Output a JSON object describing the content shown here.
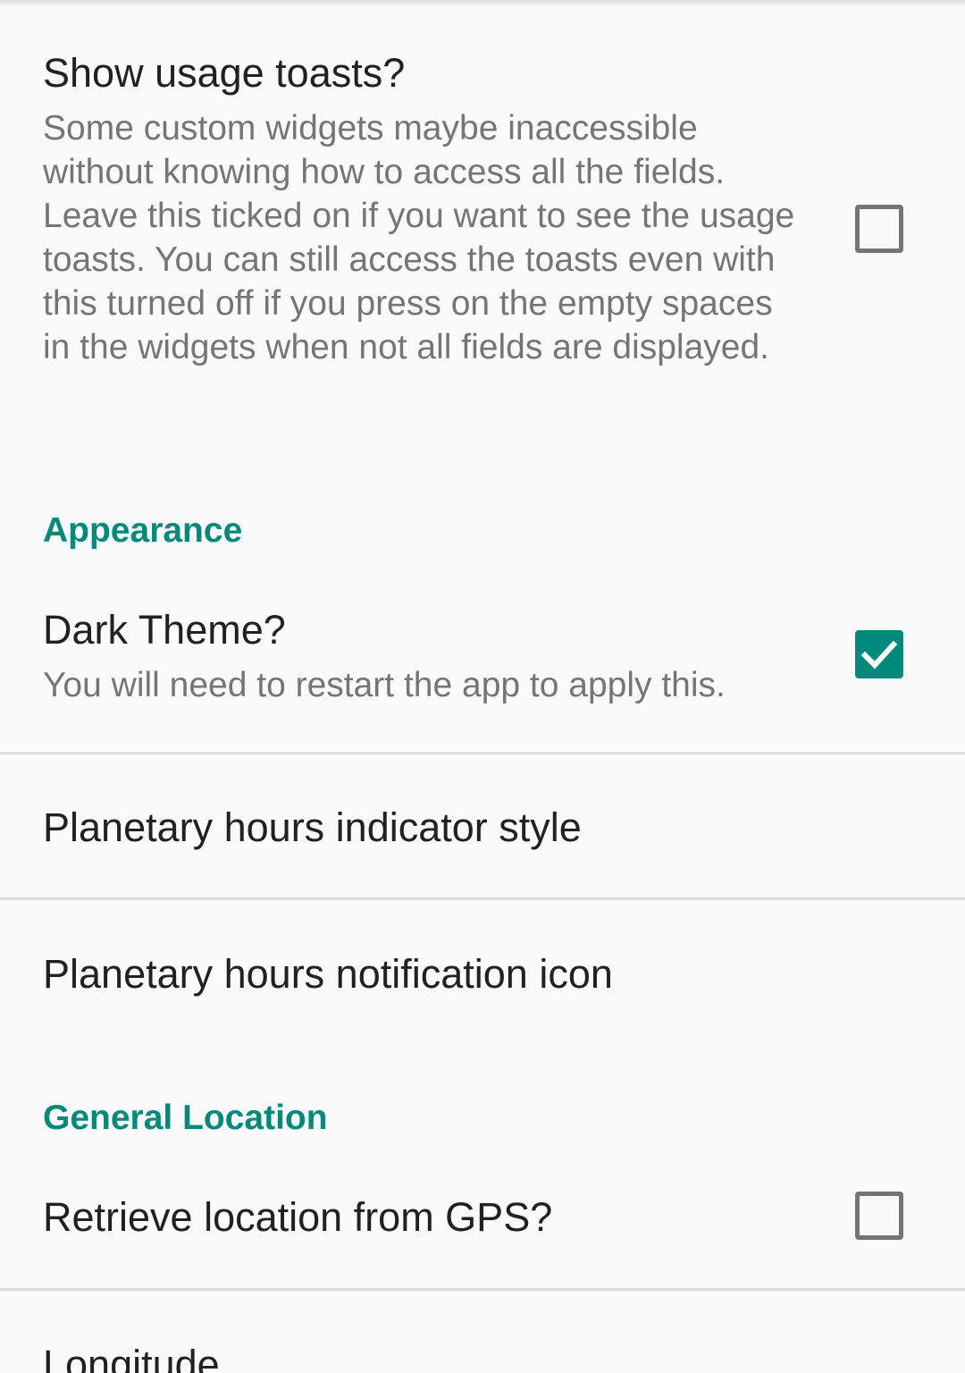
{
  "preferences": {
    "usage_toasts": {
      "title": "Show usage toasts?",
      "summary": "Some custom widgets maybe inaccessible without knowing how to access all the fields. Leave this ticked on if you want to see the usage toasts. You can still access the toasts even with this turned off if you press on the empty spaces in the widgets when not all fields are displayed.",
      "checked": false
    },
    "appearance": {
      "category": "Appearance",
      "dark_theme": {
        "title": "Dark Theme?",
        "summary": "You will need to restart the app to apply this.",
        "checked": true
      },
      "indicator_style": {
        "title": "Planetary hours indicator style"
      },
      "notification_icon": {
        "title": "Planetary hours notification icon"
      }
    },
    "general_location": {
      "category": "General Location",
      "gps": {
        "title": "Retrieve location from GPS?",
        "checked": false
      },
      "longitude": {
        "title": "Longitude"
      }
    }
  },
  "colors": {
    "accent": "#00897b",
    "title_text": "#212121",
    "summary_text": "#757575",
    "background": "#fafafa",
    "divider": "#dcdcdc"
  }
}
